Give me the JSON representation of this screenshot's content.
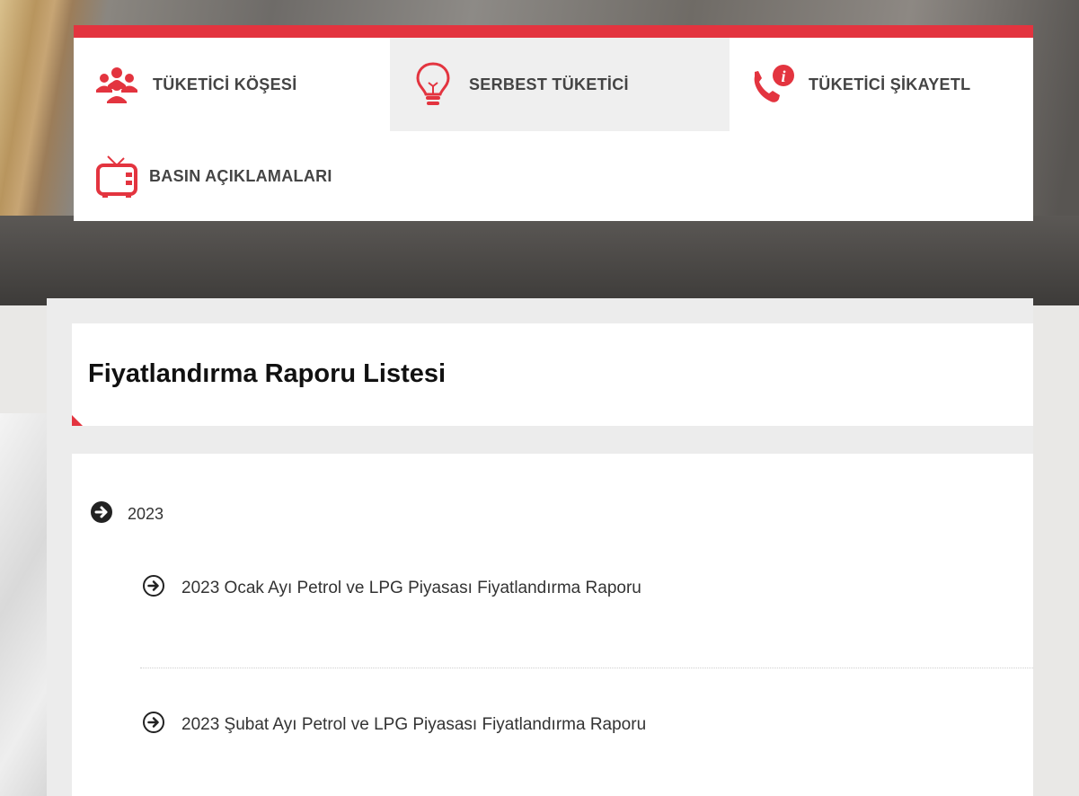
{
  "nav": {
    "items": [
      {
        "label": "TÜKETİCİ KÖŞESİ",
        "icon": "people-group-icon"
      },
      {
        "label": "SERBEST TÜKETİCİ",
        "icon": "lightbulb-icon"
      },
      {
        "label": "TÜKETİCİ ŞİKAYETL",
        "icon": "phone-info-icon"
      },
      {
        "label": "BASIN AÇIKLAMALARI",
        "icon": "tv-icon"
      }
    ],
    "accent_color": "#e3343f"
  },
  "page": {
    "title": "Fiyatlandırma Raporu Listesi"
  },
  "list": {
    "year": "2023",
    "reports": [
      {
        "label": "2023 Ocak Ayı Petrol ve LPG Piyasası Fiyatlandırma Raporu"
      },
      {
        "label": "2023 Şubat Ayı Petrol ve LPG Piyasası Fiyatlandırma Raporu"
      }
    ]
  }
}
